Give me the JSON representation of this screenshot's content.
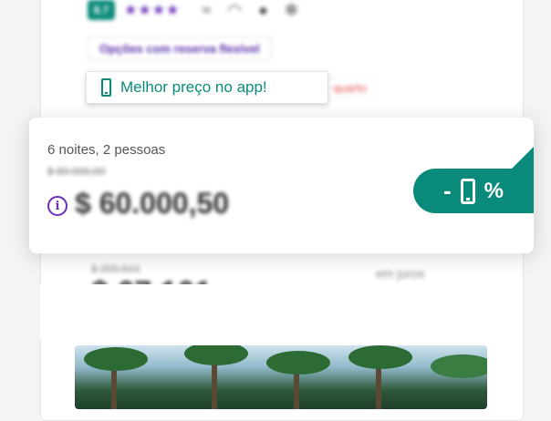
{
  "card": {
    "rating_score": "8.7",
    "stars": "★★★★",
    "amenity_icons": [
      "pool-icon",
      "wifi-icon",
      "view-icon",
      "ac-icon"
    ],
    "flexible_label": "Opções com reserva flexível",
    "room_label": "quarto",
    "installments_label": "em juros",
    "old_price_bottom": "$ 209.610"
  },
  "app_badge": {
    "label": "Melhor preço no app!",
    "icon": "phone-icon"
  },
  "popup": {
    "nights_label": "6 noites, 2 pessoas",
    "old_price": "$ 80.000,00",
    "price": "$ 60.000,50",
    "info_icon": "info-icon",
    "discount": {
      "minus": "-",
      "percent": "%",
      "icon": "phone-icon"
    }
  },
  "colors": {
    "accent_teal": "#0a8a7a",
    "accent_purple": "#6a2fb8"
  }
}
